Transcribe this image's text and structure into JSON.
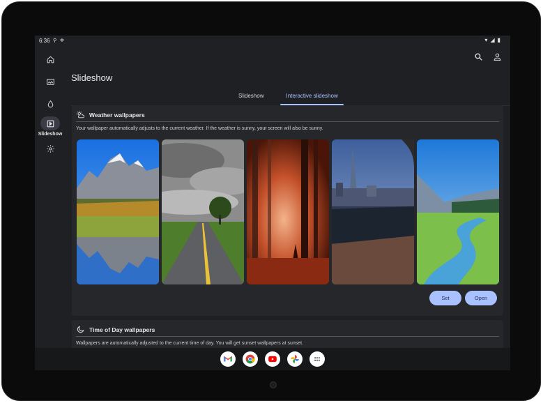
{
  "status_bar": {
    "time": "6:36",
    "icons": [
      "wifi-icon",
      "signal-icon",
      "battery-icon"
    ]
  },
  "nav_rail": {
    "items": [
      {
        "name": "home",
        "icon": "home-icon",
        "label": ""
      },
      {
        "name": "gallery",
        "icon": "gallery-icon",
        "label": ""
      },
      {
        "name": "theme",
        "icon": "palette-icon",
        "label": ""
      },
      {
        "name": "slideshow",
        "icon": "slideshow-icon",
        "label": "Slideshow",
        "active": true
      },
      {
        "name": "settings",
        "icon": "gear-icon",
        "label": ""
      }
    ]
  },
  "header": {
    "title": "Slideshow",
    "actions": [
      "search-icon",
      "account-icon"
    ]
  },
  "tabs": [
    {
      "label": "Slideshow",
      "active": false
    },
    {
      "label": "Interactive slideshow",
      "active": true
    }
  ],
  "weather_card": {
    "title": "Weather wallpapers",
    "icon": "weather-icon",
    "description": "Your wallpaper automatically adjusts to the current weather. If the weather is sunny, your screen will also be sunny.",
    "set_label": "Set",
    "open_label": "Open"
  },
  "time_card": {
    "title": "Time of Day wallpapers",
    "icon": "moon-icon",
    "description": "Wallpapers are automatically adjusted to the current time of day. You will get sunset wallpapers at sunset."
  },
  "dock": {
    "apps": [
      "gmail-icon",
      "chrome-icon",
      "youtube-icon",
      "photos-icon",
      "app-drawer-icon"
    ]
  },
  "colors": {
    "accent": "#a9c2ff",
    "background": "#1f2023",
    "card": "#26272a"
  }
}
